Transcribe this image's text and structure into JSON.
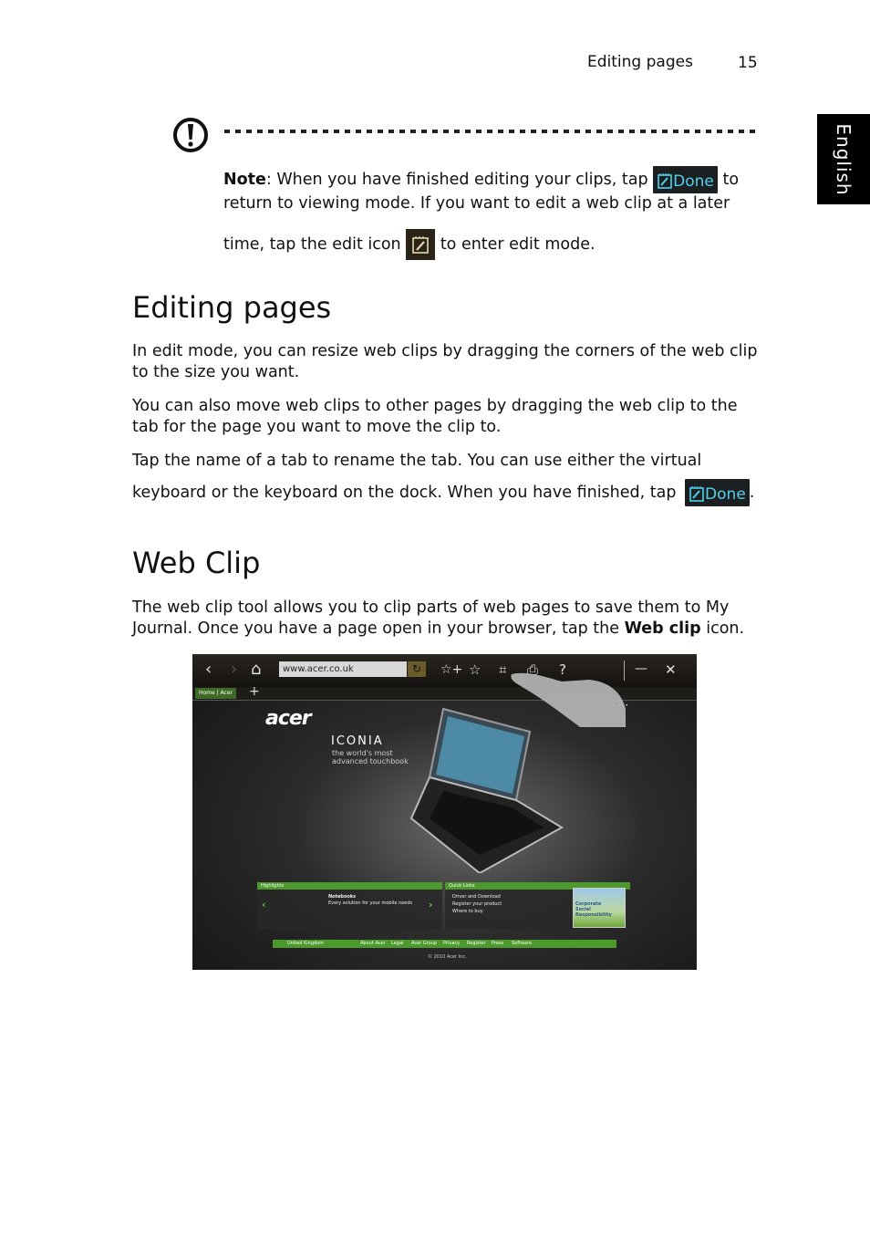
{
  "header": {
    "section_title": "Editing pages",
    "page_number": "15"
  },
  "language_tab": "English",
  "note": {
    "icon": "exclamation-circle-icon",
    "label": "Note",
    "line1_a": ": When you have finished editing your clips, tap",
    "line1_b": "to",
    "line2": "return to viewing mode. If you want to edit a web clip at a later",
    "line3_a": "time, tap the edit icon",
    "line3_b": "to enter edit mode.",
    "done_button_label": "Done"
  },
  "editing_pages": {
    "heading": "Editing pages",
    "para1": "In edit mode, you can resize web clips by dragging the corners of the web clip to the size you want.",
    "para2": "You can also move web clips to other pages by dragging the web clip to the tab for the page you want to move the clip to.",
    "para3": "Tap the name of a tab to rename the tab. You can use either the virtual",
    "para4": "keyboard or the keyboard on the dock. When you have finished, tap",
    "para4_end": ".",
    "done_button_label": "Done"
  },
  "web_clip": {
    "heading": "Web Clip",
    "para_a": "The web clip tool allows you to clip parts of web pages to save them to My Journal. Once you have a page open in your browser, tap the ",
    "para_bold": "Web clip",
    "para_b": " icon."
  },
  "screenshot": {
    "toolbar": {
      "back": "‹",
      "forward": "›",
      "home": "⌂",
      "url": "www.acer.co.uk",
      "reload": "↻",
      "add_bookmark": "☆+",
      "bookmarks": "☆",
      "web_clip": "⌗",
      "print": "⎙",
      "help": "?",
      "minimize": "—",
      "close": "✕"
    },
    "tab": {
      "label": "Home | Acer",
      "add": "+"
    },
    "pager": "• • •",
    "logo": "acer",
    "product": "ICONIA",
    "tagline_1": "the world's most",
    "tagline_2": "advanced touchbook",
    "highlights": {
      "title": "Highlights",
      "item_title": "Notebooks",
      "item_desc": "Every solution for your mobile needs"
    },
    "quick_links": {
      "title": "Quick Links",
      "links": [
        "Driver and Download",
        "Register your product",
        "Where to buy"
      ]
    },
    "csr": [
      "Corporate",
      "Social",
      "Responsibility"
    ],
    "footer": {
      "region": "United Kingdom",
      "links": [
        "About Acer",
        "Legal",
        "Acer Group",
        "Privacy",
        "Register",
        "Press",
        "Software"
      ]
    },
    "copyright": "© 2010 Acer Inc."
  }
}
